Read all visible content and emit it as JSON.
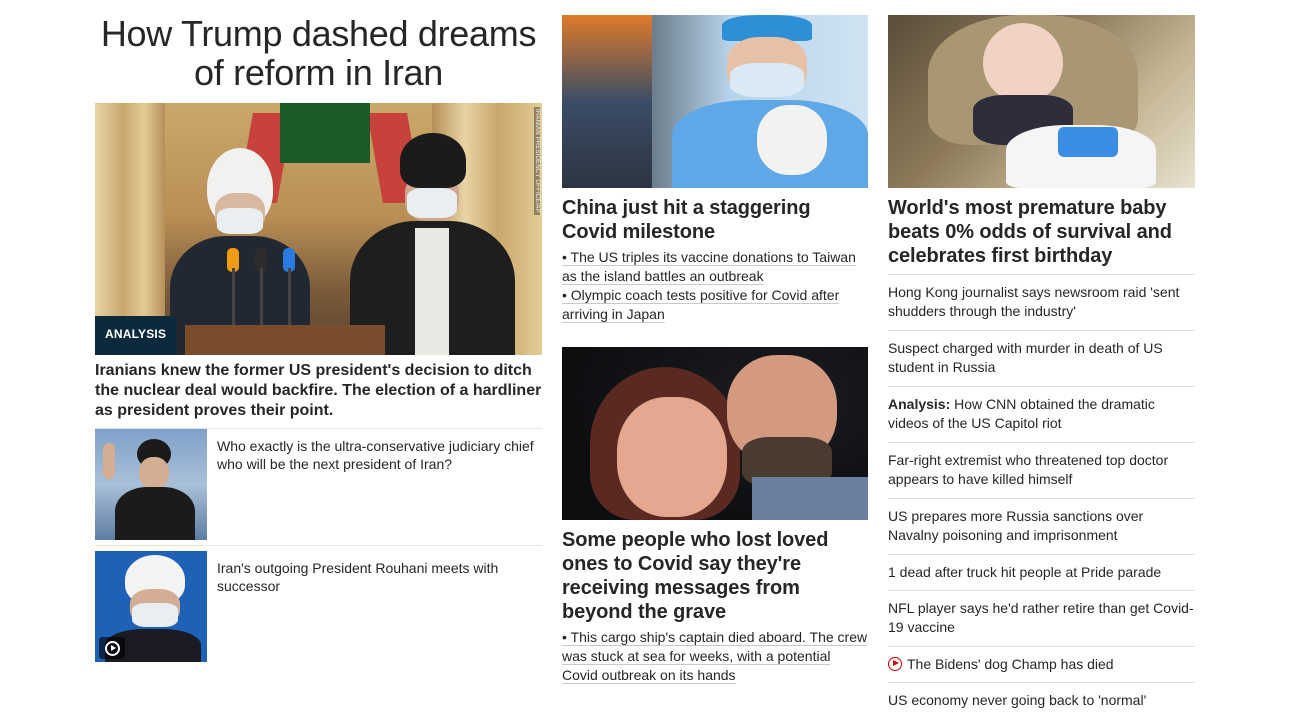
{
  "left": {
    "headline": "How Trump dashed dreams of reform in Iran",
    "hero": {
      "badge": "ANALYSIS",
      "photo_credit": "IRANIAN PRESIDENCY OFFICE/AP",
      "summary": "Iranians knew the former US president's decision to ditch the nuclear deal would backfire. The election of a hardliner as president proves their point."
    },
    "related": [
      {
        "text": "Who exactly is the ultra-conservative judiciary chief who will be the next president of Iran?"
      },
      {
        "text": "Iran's outgoing President Rouhani meets with successor",
        "icon": "play-icon"
      }
    ]
  },
  "middle": {
    "story1": {
      "title": "China just hit a staggering Covid milestone",
      "bullets": [
        "• The US triples its vaccine donations to Taiwan as the island battles an outbreak",
        "• Olympic coach tests positive for Covid after arriving in Japan"
      ]
    },
    "story2": {
      "title": "Some people who lost loved ones to Covid say they're receiving messages from beyond the grave",
      "bullets": [
        "• This cargo ship's captain died aboard. The crew was stuck at sea for weeks, with a potential Covid outbreak on its hands"
      ]
    }
  },
  "right": {
    "title": "World's most premature baby beats 0% odds of survival and celebrates first birthday",
    "headlines": [
      {
        "text": "Hong Kong journalist says newsroom raid 'sent shudders through the industry'"
      },
      {
        "text": "Suspect charged with murder in death of US student in Russia"
      },
      {
        "prefix": "Analysis:",
        "text": " How CNN obtained the dramatic videos of the US Capitol riot"
      },
      {
        "text": "Far-right extremist who threatened top doctor appears to have killed himself"
      },
      {
        "text": "US prepares more Russia sanctions over Navalny poisoning and imprisonment"
      },
      {
        "text": "1 dead after truck hit people at Pride parade"
      },
      {
        "text": "NFL player says he'd rather retire than get Covid-19 vaccine"
      },
      {
        "text": "The Bidens' dog Champ has died",
        "icon": "video-icon"
      },
      {
        "text": "US economy never going back to 'normal'"
      }
    ]
  },
  "colors": {
    "text": "#262626",
    "badge_bg": "#0c2a3b",
    "video_red": "#cc0000",
    "divider": "#e0e0e0"
  }
}
